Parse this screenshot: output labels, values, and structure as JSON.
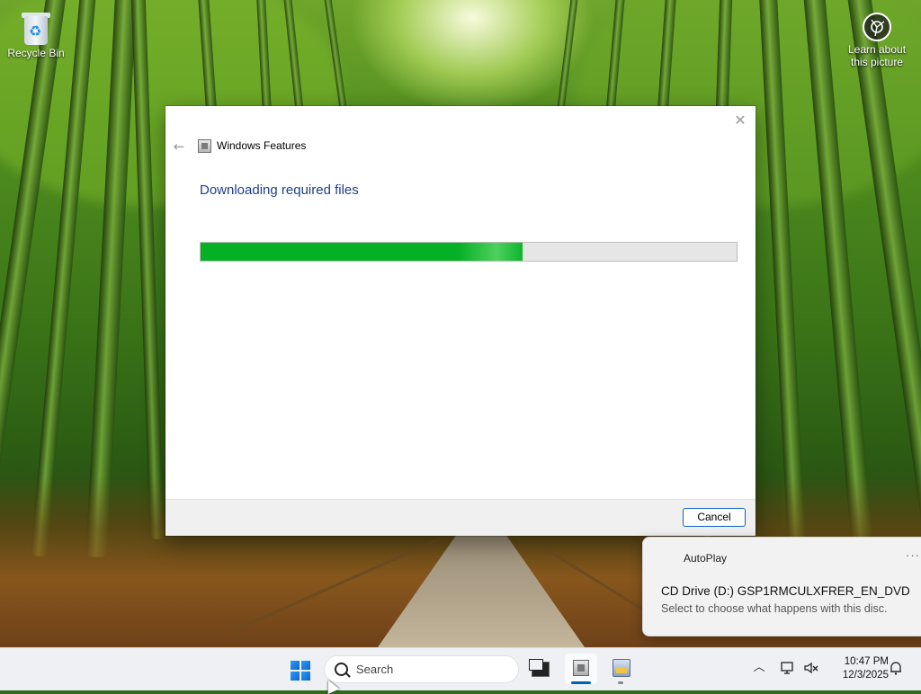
{
  "desktop": {
    "recycle_bin_label": "Recycle Bin",
    "learn_about_label_1": "Learn about",
    "learn_about_label_2": "this picture"
  },
  "dialog": {
    "title": "Windows Features",
    "heading": "Downloading required files",
    "progress_percent": 60,
    "cancel_label": "Cancel",
    "accent_color": "#06b025"
  },
  "toast": {
    "app_name": "AutoPlay",
    "more_label": "···",
    "title": "CD Drive (D:) GSP1RMCULXFRER_EN_DVD",
    "body": "Select to choose what happens with this disc."
  },
  "taskbar": {
    "search_placeholder": "Search",
    "time": "10:47 PM",
    "date": "12/3/2025"
  },
  "icons": {
    "back": "back-arrow-icon",
    "close": "close-icon",
    "start": "windows-logo-icon",
    "search": "search-icon",
    "tray_chevron": "chevron-up-icon",
    "network": "network-icon",
    "volume": "volume-muted-icon",
    "notifications": "notification-icon"
  }
}
